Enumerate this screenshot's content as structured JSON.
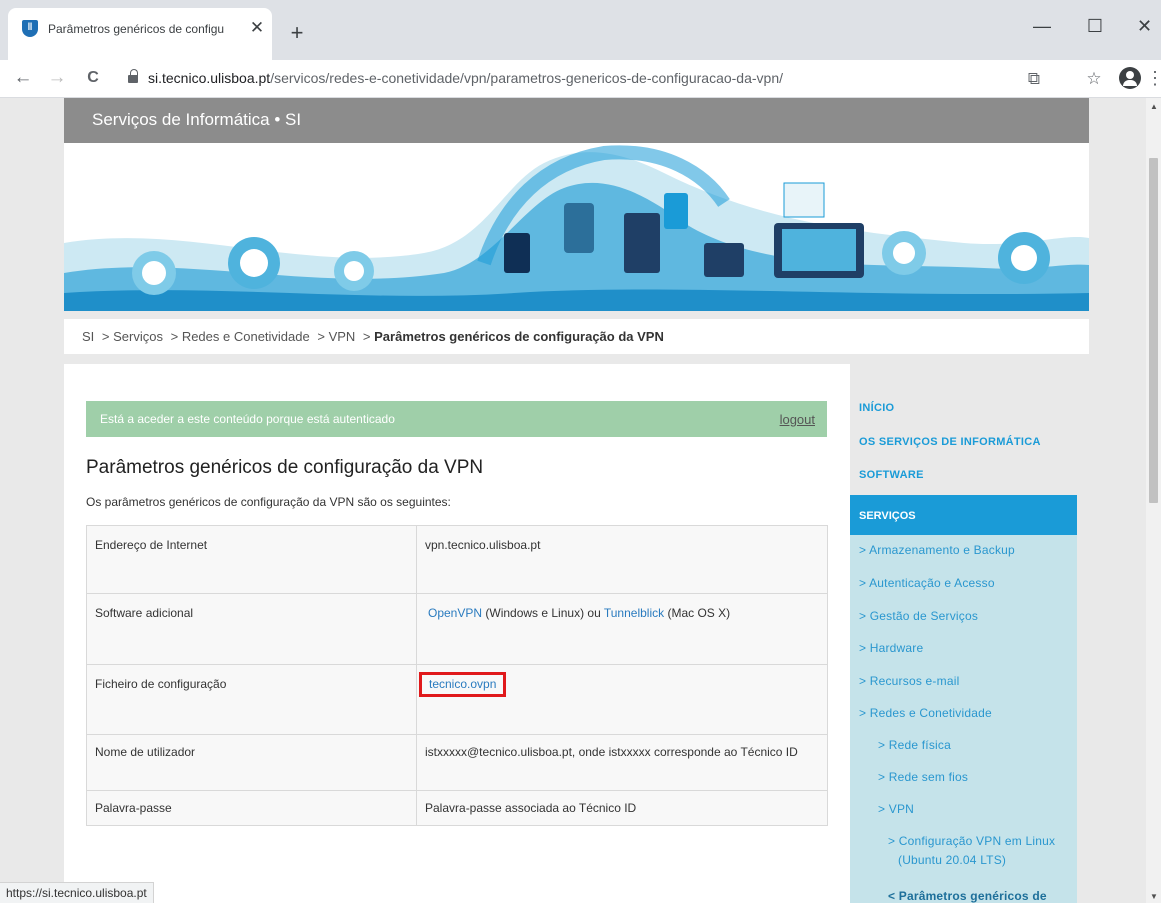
{
  "browser": {
    "tab_title": "Parâmetros genéricos de configu",
    "tab_close": "✕",
    "new_tab": "+",
    "minimize": "—",
    "maximize": "☐",
    "close": "✕",
    "back": "←",
    "forward": "→",
    "reload": "C",
    "url_host": "si.tecnico.ulisboa.pt",
    "url_path": "/servicos/redes-e-conetividade/vpn/parametros-genericos-de-configuracao-da-vpn/",
    "translate_icon": "⧉",
    "star_icon": "☆",
    "menu_icon": "⋮",
    "status_url": "https://si.tecnico.ulisboa.pt"
  },
  "site": {
    "title": "Serviços de Informática • SI"
  },
  "breadcrumb": {
    "items": [
      "SI",
      "> Serviços",
      "> Redes e Conetividade",
      "> VPN",
      "> "
    ],
    "current": "Parâmetros genéricos de configuração da VPN"
  },
  "auth": {
    "message": "Está a aceder a este conteúdo porque está autenticado",
    "logout": "logout"
  },
  "main": {
    "title": "Parâmetros genéricos de configuração da VPN",
    "intro": "Os parâmetros genéricos de configuração da VPN são os seguintes:"
  },
  "params": {
    "rows": [
      {
        "key": "Endereço de Internet",
        "value": "vpn.tecnico.ulisboa.pt"
      },
      {
        "key": "Software adicional",
        "link1": "OpenVPN",
        "mid": " (Windows e Linux) ou ",
        "link2": "Tunnelblick",
        "tail": " (Mac OS X)"
      },
      {
        "key": "Ficheiro de configuração",
        "link": "tecnico.ovpn"
      },
      {
        "key": "Nome de utilizador",
        "value": "istxxxxx@tecnico.ulisboa.pt, onde istxxxxx corresponde ao Técnico ID"
      },
      {
        "key": "Palavra-passe",
        "value": "Palavra-passe associada ao Técnico ID"
      }
    ]
  },
  "sidebar": {
    "top": [
      "INÍCIO",
      "OS SERVIÇOS DE INFORMÁTICA",
      "SOFTWARE"
    ],
    "services": "SERVIÇOS",
    "items": [
      "> Armazenamento e Backup",
      "> Autenticação e Acesso",
      "> Gestão de Serviços",
      "> Hardware",
      "> Recursos e-mail",
      "> Redes e Conetividade",
      "> Rede física",
      "> Rede sem fios",
      "> VPN",
      "> Configuração VPN em Linux",
      "(Ubuntu 20.04 LTS)",
      "< Parâmetros genéricos de"
    ]
  },
  "colors": {
    "accent": "#1a9bd7",
    "header_gray": "#8c8c8c",
    "auth_green": "#9fcfa9",
    "highlight_red": "#e0191b",
    "sidebar_light": "#c5e3ea"
  }
}
